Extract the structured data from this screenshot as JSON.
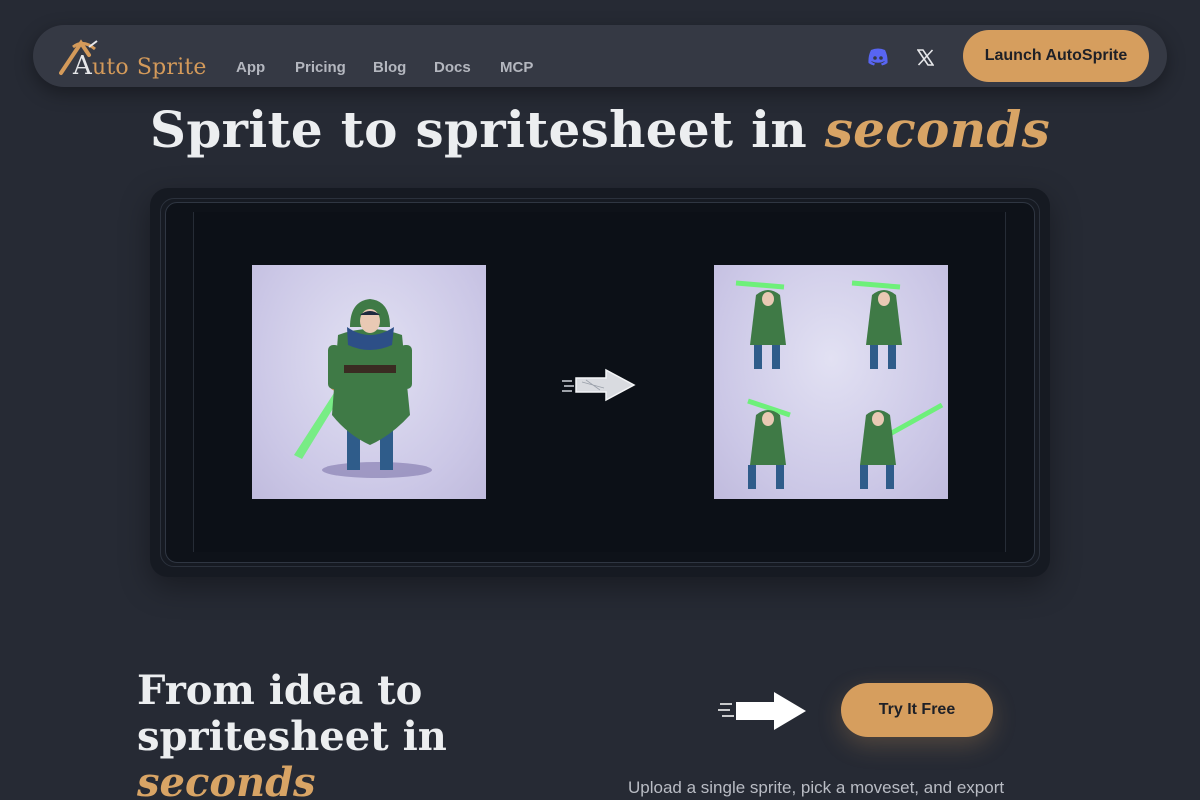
{
  "nav": {
    "logo_a": "A",
    "logo_uto": "uto",
    "logo_sprite": "Sprite",
    "links": [
      "App",
      "Pricing",
      "Blog",
      "Docs",
      "MCP"
    ],
    "launch_label": "Launch AutoSprite"
  },
  "hero": {
    "title_main": "Sprite to spritesheet in ",
    "title_accent": "seconds"
  },
  "lower": {
    "title_line1": "From idea to",
    "title_line2": "spritesheet in",
    "title_accent": "seconds",
    "try_label": "Try It Free",
    "description": "Upload a single sprite, pick a moveset, and export"
  },
  "colors": {
    "accent": "#d69e5e",
    "background": "#262a34",
    "discord": "#5865f2"
  },
  "icons": {
    "discord": "discord-icon",
    "x": "x-icon",
    "arrow": "arrow-right-icon"
  }
}
